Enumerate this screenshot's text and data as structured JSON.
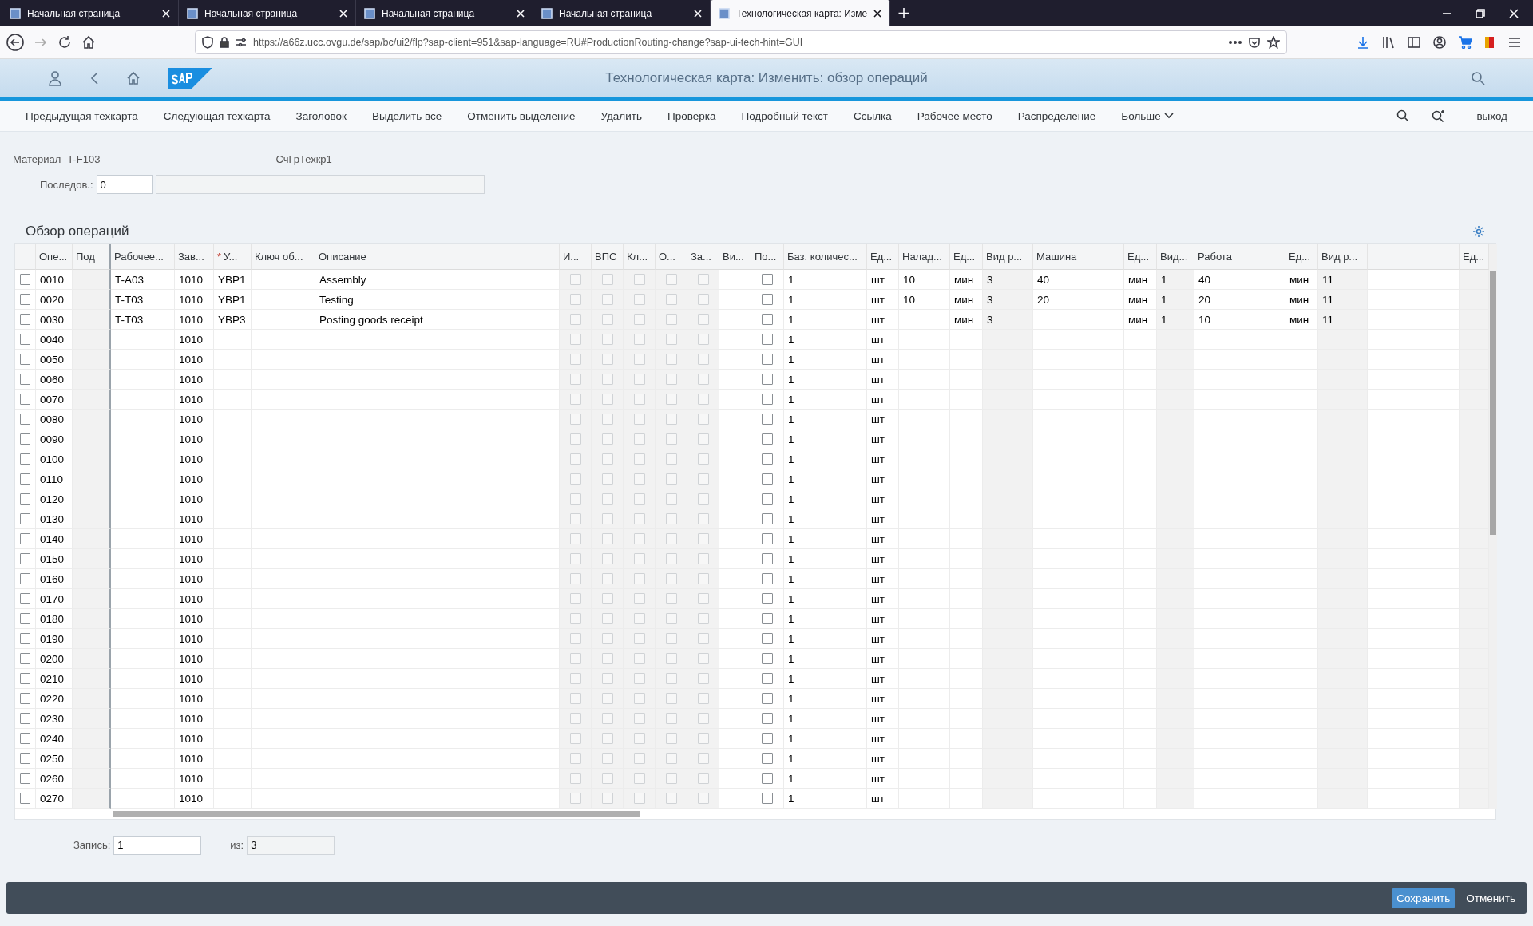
{
  "browser": {
    "tabs": [
      {
        "title": "Начальная страница",
        "selected": false
      },
      {
        "title": "Начальная страница",
        "selected": false
      },
      {
        "title": "Начальная страница",
        "selected": false
      },
      {
        "title": "Начальная страница",
        "selected": false
      },
      {
        "title": "Технологическая карта: Изме",
        "selected": true
      }
    ],
    "url": "https://a66z.ucc.ovgu.de/sap/bc/ui2/flp?sap-client=951&sap-language=RU#ProductionRouting-change?sap-ui-tech-hint=GUI"
  },
  "shell": {
    "title": "Технологическая карта: Изменить: обзор операций"
  },
  "toolbar": {
    "buttons": [
      "Предыдущая техкарта",
      "Следующая техкарта",
      "Заголовок",
      "Выделить все",
      "Отменить выделение",
      "Удалить",
      "Проверка",
      "Подробный текст",
      "Ссылка",
      "Рабочее место",
      "Распределение"
    ],
    "more": "Больше",
    "exit": "выход"
  },
  "header": {
    "material_label": "Материал",
    "material": "T-F103",
    "group": "СчГрТехкр1",
    "sequence_label": "Последов.:",
    "sequence": "0"
  },
  "section": {
    "title": "Обзор операций"
  },
  "table": {
    "columns": [
      {
        "kind": "text",
        "label": "Опе..."
      },
      {
        "kind": "text",
        "label": "Под",
        "disabled": true
      },
      {
        "kind": "text",
        "label": "Рабочее..."
      },
      {
        "kind": "text",
        "label": "Зав..."
      },
      {
        "kind": "text",
        "label": "У...",
        "required_mark": "*"
      },
      {
        "kind": "text",
        "label": "Ключ об..."
      },
      {
        "kind": "text",
        "label": "Описание"
      },
      {
        "kind": "check",
        "label": "И...",
        "disabled": true
      },
      {
        "kind": "check",
        "label": "ВПС",
        "disabled": true
      },
      {
        "kind": "check",
        "label": "Кл...",
        "disabled": true
      },
      {
        "kind": "check",
        "label": "О...",
        "disabled": true
      },
      {
        "kind": "check",
        "label": "За...",
        "disabled": true
      },
      {
        "kind": "text",
        "label": "Ви..."
      },
      {
        "kind": "check",
        "label": "По..."
      },
      {
        "kind": "text",
        "label": "Баз. количес..."
      },
      {
        "kind": "text",
        "label": "Ед..."
      },
      {
        "kind": "text",
        "label": "Налад..."
      },
      {
        "kind": "text",
        "label": "Ед..."
      },
      {
        "kind": "text",
        "label": "Вид р...",
        "disabled": true
      },
      {
        "kind": "text",
        "label": "Машина"
      },
      {
        "kind": "text",
        "label": "Ед..."
      },
      {
        "kind": "text",
        "label": "Вид...",
        "disabled": true
      },
      {
        "kind": "text",
        "label": "Работа"
      },
      {
        "kind": "text",
        "label": "Ед..."
      },
      {
        "kind": "text",
        "label": "Вид р...",
        "disabled": true
      },
      {
        "kind": "text"
      },
      {
        "kind": "text",
        "label": "Ед...",
        "disabled": true
      }
    ],
    "rows": [
      {
        "selected": false,
        "cells": [
          "0010",
          null,
          "T-A03",
          "1010",
          "YBP1",
          null,
          "Assembly",
          false,
          false,
          false,
          false,
          false,
          null,
          false,
          "1",
          "шт",
          "10",
          "мин",
          "3",
          "40",
          "мин",
          "1",
          "40",
          "мин",
          "11",
          null,
          null
        ]
      },
      {
        "selected": false,
        "cells": [
          "0020",
          null,
          "T-T03",
          "1010",
          "YBP1",
          null,
          "Testing",
          false,
          false,
          false,
          false,
          false,
          null,
          false,
          "1",
          "шт",
          "10",
          "мин",
          "3",
          "20",
          "мин",
          "1",
          "20",
          "мин",
          "11",
          null,
          null
        ]
      },
      {
        "selected": false,
        "cells": [
          "0030",
          null,
          "T-T03",
          "1010",
          "YBP3",
          null,
          "Posting goods receipt",
          false,
          false,
          false,
          false,
          false,
          null,
          false,
          "1",
          "шт",
          null,
          "мин",
          "3",
          null,
          "мин",
          "1",
          "10",
          "мин",
          "11",
          null,
          null
        ]
      },
      {
        "selected": false,
        "cells": [
          "0040",
          null,
          null,
          "1010",
          null,
          null,
          null,
          false,
          false,
          false,
          false,
          false,
          null,
          false,
          "1",
          "шт",
          null,
          null,
          null,
          null,
          null,
          null,
          null,
          null,
          null,
          null,
          null
        ]
      },
      {
        "selected": false,
        "cells": [
          "0050",
          null,
          null,
          "1010",
          null,
          null,
          null,
          false,
          false,
          false,
          false,
          false,
          null,
          false,
          "1",
          "шт",
          null,
          null,
          null,
          null,
          null,
          null,
          null,
          null,
          null,
          null,
          null
        ]
      },
      {
        "selected": false,
        "cells": [
          "0060",
          null,
          null,
          "1010",
          null,
          null,
          null,
          false,
          false,
          false,
          false,
          false,
          null,
          false,
          "1",
          "шт",
          null,
          null,
          null,
          null,
          null,
          null,
          null,
          null,
          null,
          null,
          null
        ]
      },
      {
        "selected": false,
        "cells": [
          "0070",
          null,
          null,
          "1010",
          null,
          null,
          null,
          false,
          false,
          false,
          false,
          false,
          null,
          false,
          "1",
          "шт",
          null,
          null,
          null,
          null,
          null,
          null,
          null,
          null,
          null,
          null,
          null
        ]
      },
      {
        "selected": false,
        "cells": [
          "0080",
          null,
          null,
          "1010",
          null,
          null,
          null,
          false,
          false,
          false,
          false,
          false,
          null,
          false,
          "1",
          "шт",
          null,
          null,
          null,
          null,
          null,
          null,
          null,
          null,
          null,
          null,
          null
        ]
      },
      {
        "selected": false,
        "cells": [
          "0090",
          null,
          null,
          "1010",
          null,
          null,
          null,
          false,
          false,
          false,
          false,
          false,
          null,
          false,
          "1",
          "шт",
          null,
          null,
          null,
          null,
          null,
          null,
          null,
          null,
          null,
          null,
          null
        ]
      },
      {
        "selected": false,
        "cells": [
          "0100",
          null,
          null,
          "1010",
          null,
          null,
          null,
          false,
          false,
          false,
          false,
          false,
          null,
          false,
          "1",
          "шт",
          null,
          null,
          null,
          null,
          null,
          null,
          null,
          null,
          null,
          null,
          null
        ]
      },
      {
        "selected": false,
        "cells": [
          "0110",
          null,
          null,
          "1010",
          null,
          null,
          null,
          false,
          false,
          false,
          false,
          false,
          null,
          false,
          "1",
          "шт",
          null,
          null,
          null,
          null,
          null,
          null,
          null,
          null,
          null,
          null,
          null
        ]
      },
      {
        "selected": false,
        "cells": [
          "0120",
          null,
          null,
          "1010",
          null,
          null,
          null,
          false,
          false,
          false,
          false,
          false,
          null,
          false,
          "1",
          "шт",
          null,
          null,
          null,
          null,
          null,
          null,
          null,
          null,
          null,
          null,
          null
        ]
      },
      {
        "selected": false,
        "cells": [
          "0130",
          null,
          null,
          "1010",
          null,
          null,
          null,
          false,
          false,
          false,
          false,
          false,
          null,
          false,
          "1",
          "шт",
          null,
          null,
          null,
          null,
          null,
          null,
          null,
          null,
          null,
          null,
          null
        ]
      },
      {
        "selected": false,
        "cells": [
          "0140",
          null,
          null,
          "1010",
          null,
          null,
          null,
          false,
          false,
          false,
          false,
          false,
          null,
          false,
          "1",
          "шт",
          null,
          null,
          null,
          null,
          null,
          null,
          null,
          null,
          null,
          null,
          null
        ]
      },
      {
        "selected": false,
        "cells": [
          "0150",
          null,
          null,
          "1010",
          null,
          null,
          null,
          false,
          false,
          false,
          false,
          false,
          null,
          false,
          "1",
          "шт",
          null,
          null,
          null,
          null,
          null,
          null,
          null,
          null,
          null,
          null,
          null
        ]
      },
      {
        "selected": false,
        "cells": [
          "0160",
          null,
          null,
          "1010",
          null,
          null,
          null,
          false,
          false,
          false,
          false,
          false,
          null,
          false,
          "1",
          "шт",
          null,
          null,
          null,
          null,
          null,
          null,
          null,
          null,
          null,
          null,
          null
        ]
      },
      {
        "selected": false,
        "cells": [
          "0170",
          null,
          null,
          "1010",
          null,
          null,
          null,
          false,
          false,
          false,
          false,
          false,
          null,
          false,
          "1",
          "шт",
          null,
          null,
          null,
          null,
          null,
          null,
          null,
          null,
          null,
          null,
          null
        ]
      },
      {
        "selected": false,
        "cells": [
          "0180",
          null,
          null,
          "1010",
          null,
          null,
          null,
          false,
          false,
          false,
          false,
          false,
          null,
          false,
          "1",
          "шт",
          null,
          null,
          null,
          null,
          null,
          null,
          null,
          null,
          null,
          null,
          null
        ]
      },
      {
        "selected": false,
        "cells": [
          "0190",
          null,
          null,
          "1010",
          null,
          null,
          null,
          false,
          false,
          false,
          false,
          false,
          null,
          false,
          "1",
          "шт",
          null,
          null,
          null,
          null,
          null,
          null,
          null,
          null,
          null,
          null,
          null
        ]
      },
      {
        "selected": false,
        "cells": [
          "0200",
          null,
          null,
          "1010",
          null,
          null,
          null,
          false,
          false,
          false,
          false,
          false,
          null,
          false,
          "1",
          "шт",
          null,
          null,
          null,
          null,
          null,
          null,
          null,
          null,
          null,
          null,
          null
        ]
      },
      {
        "selected": false,
        "cells": [
          "0210",
          null,
          null,
          "1010",
          null,
          null,
          null,
          false,
          false,
          false,
          false,
          false,
          null,
          false,
          "1",
          "шт",
          null,
          null,
          null,
          null,
          null,
          null,
          null,
          null,
          null,
          null,
          null
        ]
      },
      {
        "selected": false,
        "cells": [
          "0220",
          null,
          null,
          "1010",
          null,
          null,
          null,
          false,
          false,
          false,
          false,
          false,
          null,
          false,
          "1",
          "шт",
          null,
          null,
          null,
          null,
          null,
          null,
          null,
          null,
          null,
          null,
          null
        ]
      },
      {
        "selected": false,
        "cells": [
          "0230",
          null,
          null,
          "1010",
          null,
          null,
          null,
          false,
          false,
          false,
          false,
          false,
          null,
          false,
          "1",
          "шт",
          null,
          null,
          null,
          null,
          null,
          null,
          null,
          null,
          null,
          null,
          null
        ]
      },
      {
        "selected": false,
        "cells": [
          "0240",
          null,
          null,
          "1010",
          null,
          null,
          null,
          false,
          false,
          false,
          false,
          false,
          null,
          false,
          "1",
          "шт",
          null,
          null,
          null,
          null,
          null,
          null,
          null,
          null,
          null,
          null,
          null
        ]
      },
      {
        "selected": false,
        "cells": [
          "0250",
          null,
          null,
          "1010",
          null,
          null,
          null,
          false,
          false,
          false,
          false,
          false,
          null,
          false,
          "1",
          "шт",
          null,
          null,
          null,
          null,
          null,
          null,
          null,
          null,
          null,
          null,
          null
        ]
      },
      {
        "selected": false,
        "cells": [
          "0260",
          null,
          null,
          "1010",
          null,
          null,
          null,
          false,
          false,
          false,
          false,
          false,
          null,
          false,
          "1",
          "шт",
          null,
          null,
          null,
          null,
          null,
          null,
          null,
          null,
          null,
          null,
          null
        ]
      },
      {
        "selected": false,
        "cells": [
          "0270",
          null,
          null,
          "1010",
          null,
          null,
          null,
          false,
          false,
          false,
          false,
          false,
          null,
          false,
          "1",
          "шт",
          null,
          null,
          null,
          null,
          null,
          null,
          null,
          null,
          null,
          null,
          null
        ]
      }
    ]
  },
  "record": {
    "label": "Запись:",
    "value": "1",
    "of_label": "из:",
    "total": "3"
  },
  "footer": {
    "save": "Сохранить",
    "cancel": "Отменить"
  }
}
